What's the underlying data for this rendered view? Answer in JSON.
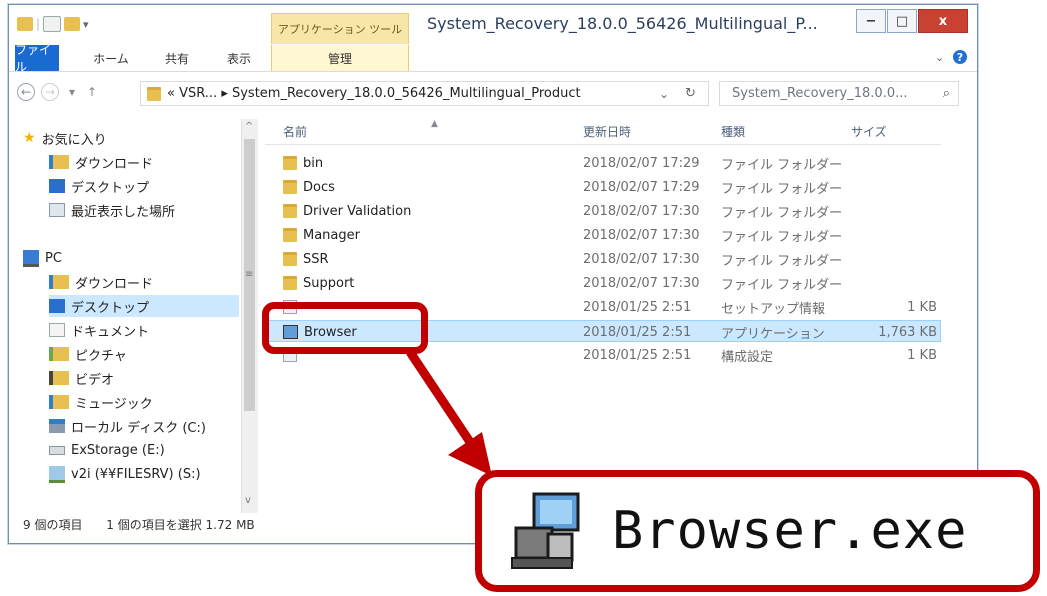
{
  "titlebar": {
    "context_tab": "アプリケーション ツール",
    "title": "System_Recovery_18.0.0_56426_Multilingual_P...",
    "minimize": "−",
    "maximize": "□",
    "close": "x"
  },
  "ribbon": {
    "tabs": [
      "ファイル",
      "ホーム",
      "共有",
      "表示"
    ],
    "manage_tab": "管理",
    "collapse": "⌄",
    "help": "?"
  },
  "address": {
    "back": "←",
    "forward": "→",
    "dropdown": "▾",
    "up": "↑",
    "path": "« VSR... ▸ System_Recovery_18.0.0_56426_Multilingual_Product",
    "addr_dropdown": "⌄",
    "refresh": "↻",
    "search_placeholder": "System_Recovery_18.0.0...",
    "search_icon": "⌕"
  },
  "nav": {
    "favorites": "お気に入り",
    "fav_items": [
      "ダウンロード",
      "デスクトップ",
      "最近表示した場所"
    ],
    "pc": "PC",
    "pc_items": [
      "ダウンロード",
      "デスクトップ",
      "ドキュメント",
      "ピクチャ",
      "ビデオ",
      "ミュージック",
      "ローカル ディスク (C:)",
      "ExStorage (E:)",
      "v2i (¥¥FILESRV) (S:)"
    ],
    "scroll_up": "^",
    "scroll_grip": "≡",
    "scroll_down": "v"
  },
  "columns": {
    "name": "名前",
    "date": "更新日時",
    "type": "種類",
    "size": "サイズ",
    "sort_indicator": "▲"
  },
  "files": [
    {
      "name": "bin",
      "date": "2018/02/07 17:29",
      "type": "ファイル フォルダー",
      "size": ""
    },
    {
      "name": "Docs",
      "date": "2018/02/07 17:29",
      "type": "ファイル フォルダー",
      "size": ""
    },
    {
      "name": "Driver Validation",
      "date": "2018/02/07 17:30",
      "type": "ファイル フォルダー",
      "size": ""
    },
    {
      "name": "Manager",
      "date": "2018/02/07 17:30",
      "type": "ファイル フォルダー",
      "size": ""
    },
    {
      "name": "SSR",
      "date": "2018/02/07 17:30",
      "type": "ファイル フォルダー",
      "size": ""
    },
    {
      "name": "Support",
      "date": "2018/02/07 17:30",
      "type": "ファイル フォルダー",
      "size": ""
    },
    {
      "name": "",
      "date": "2018/01/25 2:51",
      "type": "セットアップ情報",
      "size": "1 KB"
    },
    {
      "name": "Browser",
      "date": "2018/01/25 2:51",
      "type": "アプリケーション",
      "size": "1,763 KB"
    },
    {
      "name": "",
      "date": "2018/01/25 2:51",
      "type": "構成設定",
      "size": "1 KB"
    }
  ],
  "status": {
    "count": "9 個の項目",
    "selection": "1 個の項目を選択 1.72 MB"
  },
  "callout": {
    "text": "Browser.exe"
  },
  "colors": {
    "annotation_red": "#c00000",
    "selection": "#cce8ff",
    "file_tab": "#1a6bd1",
    "context_tab": "#f6e7a8"
  }
}
